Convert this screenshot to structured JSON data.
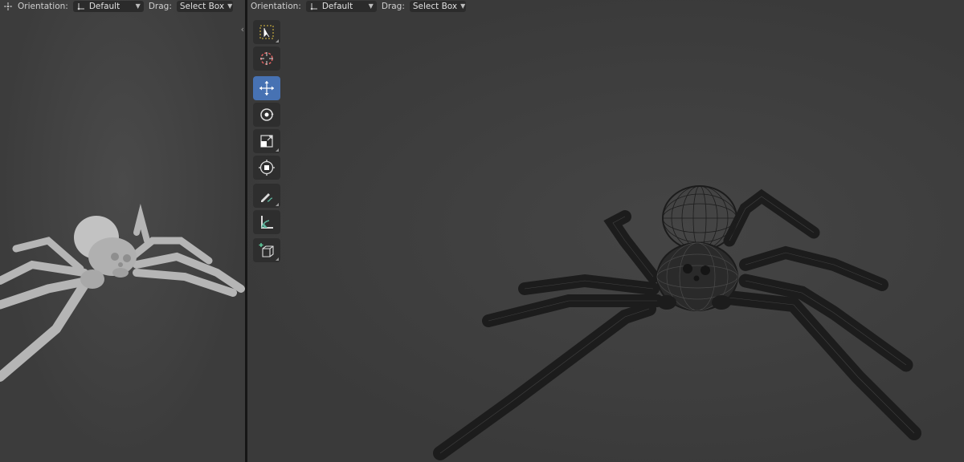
{
  "left_viewport": {
    "header": {
      "orientation_label": "Orientation:",
      "orientation_value": "Default",
      "drag_label": "Drag:",
      "drag_value": "Select Box"
    },
    "shading": "solid"
  },
  "right_viewport": {
    "header": {
      "orientation_label": "Orientation:",
      "orientation_value": "Default",
      "drag_label": "Drag:",
      "drag_value": "Select Box"
    },
    "shading": "wireframe"
  },
  "toolbar": {
    "tools": [
      {
        "icon": "select-box-icon",
        "active": false,
        "has_submenu": true
      },
      {
        "icon": "cursor-icon",
        "active": false,
        "has_submenu": false
      },
      {
        "icon": "move-icon",
        "active": true,
        "has_submenu": false
      },
      {
        "icon": "rotate-icon",
        "active": false,
        "has_submenu": false
      },
      {
        "icon": "scale-icon",
        "active": false,
        "has_submenu": true
      },
      {
        "icon": "transform-icon",
        "active": false,
        "has_submenu": false
      },
      {
        "icon": "annotate-icon",
        "active": false,
        "has_submenu": true
      },
      {
        "icon": "measure-icon",
        "active": false,
        "has_submenu": false
      },
      {
        "icon": "add-cube-icon",
        "active": false,
        "has_submenu": true
      }
    ]
  },
  "colors": {
    "viewport_bg": "#3d3d3d",
    "active_tool": "#4772b3",
    "solid_mesh": "#b5b5b5",
    "wire_mesh": "#1a1a1a"
  }
}
